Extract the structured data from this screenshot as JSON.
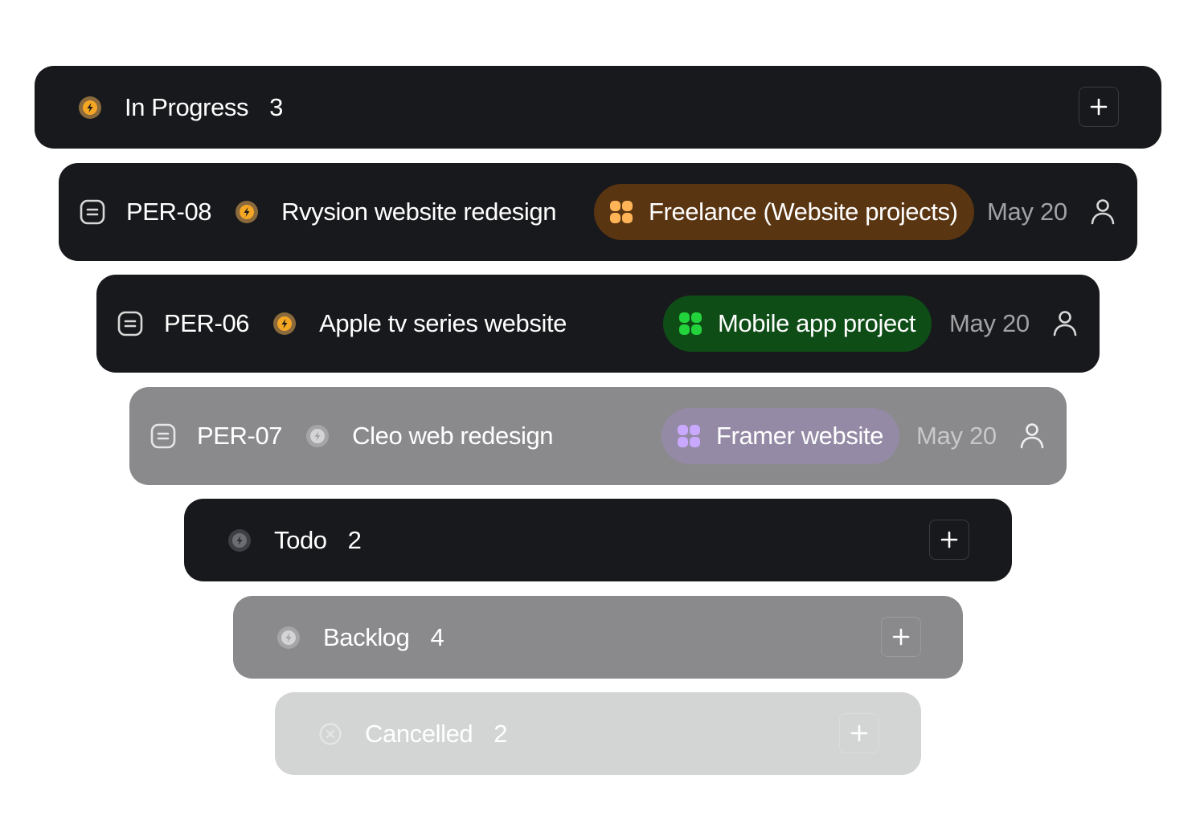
{
  "groups": {
    "in_progress": {
      "label": "In Progress",
      "count": "3",
      "status_icon": "in-progress-bolt-icon",
      "add_icon": "plus-icon"
    },
    "todo": {
      "label": "Todo",
      "count": "2",
      "status_icon": "todo-bolt-icon",
      "add_icon": "plus-icon"
    },
    "backlog": {
      "label": "Backlog",
      "count": "4",
      "status_icon": "backlog-bolt-icon",
      "add_icon": "plus-icon"
    },
    "cancelled": {
      "label": "Cancelled",
      "count": "2",
      "status_icon": "cancelled-x-icon",
      "add_icon": "plus-icon"
    }
  },
  "issues": [
    {
      "id": "PER-08",
      "title": "Rvysion website redesign",
      "project": "Freelance (Website projects)",
      "due": "May 20",
      "priority_icon": "document-icon",
      "status_icon": "in-progress-bolt-icon",
      "assignee_icon": "user-icon"
    },
    {
      "id": "PER-06",
      "title": "Apple tv series website",
      "project": "Mobile app project",
      "due": "May 20",
      "priority_icon": "document-icon",
      "status_icon": "in-progress-bolt-icon",
      "assignee_icon": "user-icon"
    },
    {
      "id": "PER-07",
      "title": "Cleo web redesign",
      "project": "Framer website",
      "due": "May 20",
      "priority_icon": "document-icon",
      "status_icon": "neutral-bolt-icon",
      "assignee_icon": "user-icon"
    }
  ],
  "colors": {
    "dark_row": "#18191c",
    "gray_row": "#8a8a8d",
    "light_row": "#d3d4d4",
    "in_progress_accent": "#f5a623",
    "freelance_pill": "#5a3511",
    "freelance_icon": "#ffb457",
    "mobile_pill": "#0f4d17",
    "mobile_icon": "#22d33c",
    "framer_pill": "#948aa5",
    "framer_icon": "#c9a8ff"
  }
}
